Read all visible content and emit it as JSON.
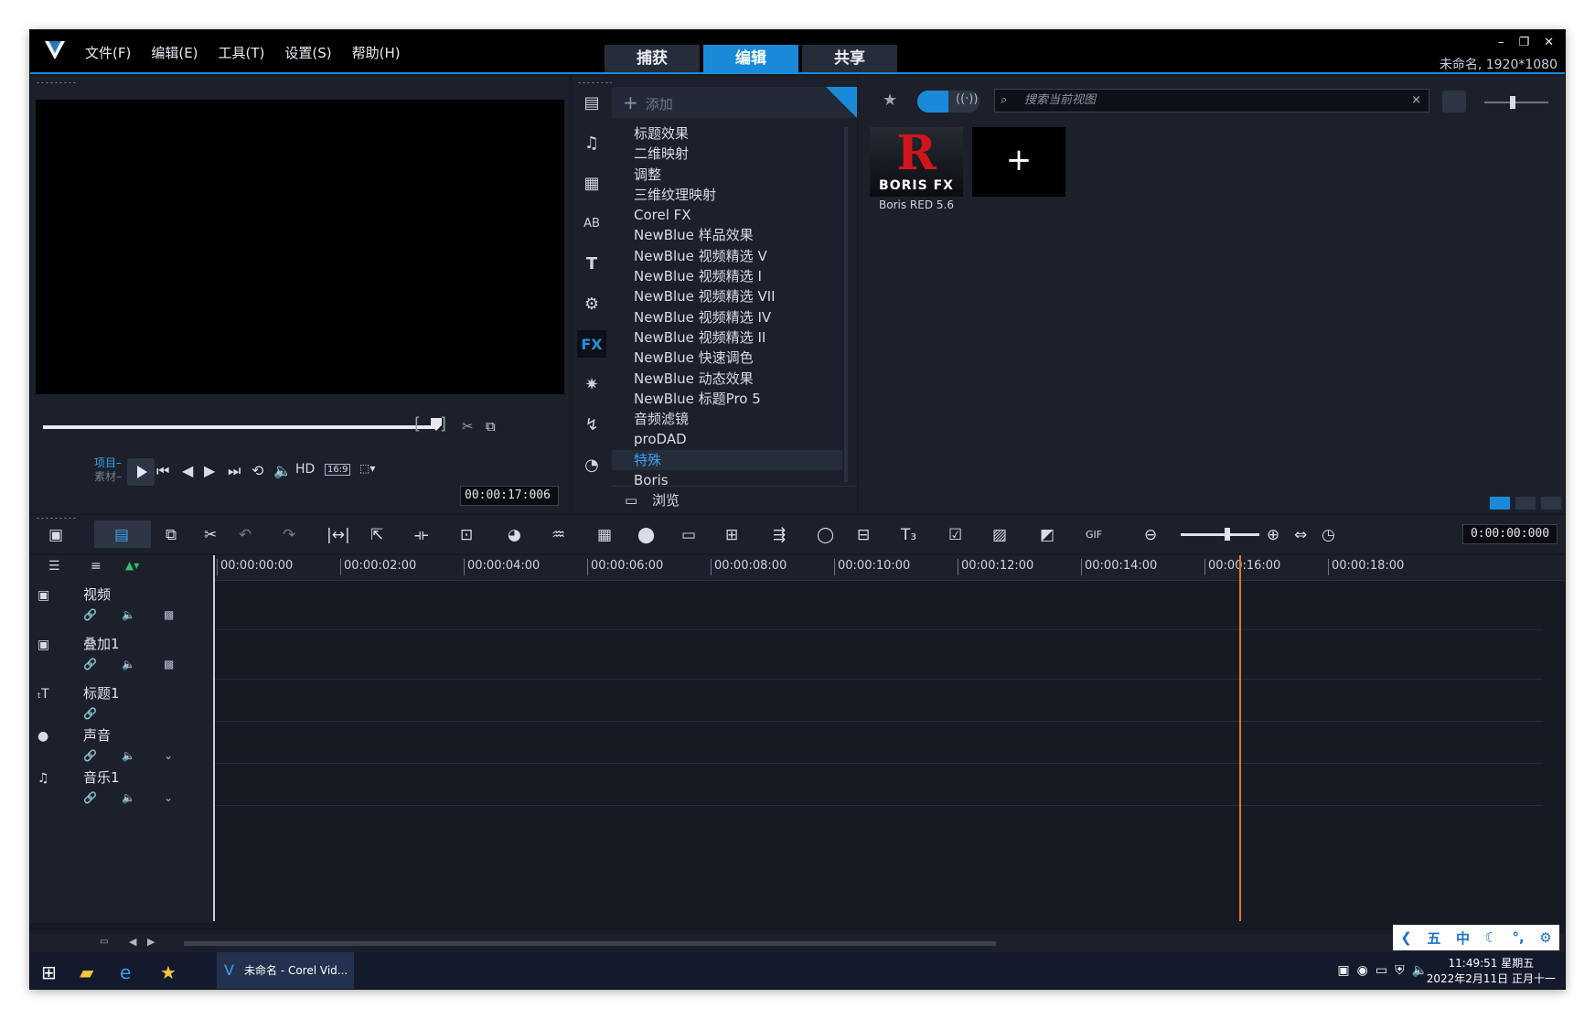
{
  "menu": [
    "文件(F)",
    "编辑(E)",
    "工具(T)",
    "设置(S)",
    "帮助(H)"
  ],
  "modes": [
    "捕获",
    "编辑",
    "共享"
  ],
  "window": {
    "project_info": "未命名, 1920*1080"
  },
  "preview": {
    "project_label": "项目",
    "clip_label": "素材",
    "hd_label": "HD",
    "ratio_label": "16:9",
    "timecode": "00:00:17:006"
  },
  "library": {
    "add_label": "添加",
    "categories": [
      "标题效果",
      "二维映射",
      "调整",
      "三维纹理映射",
      "Corel FX",
      "NewBlue 样品效果",
      "NewBlue 视频精选 V",
      "NewBlue 视频精选 I",
      "NewBlue 视频精选 VII",
      "NewBlue 视频精选 IV",
      "NewBlue 视频精选 II",
      "NewBlue 快速调色",
      "NewBlue 动态效果",
      "NewBlue 标题Pro 5",
      "音频滤镜",
      "proDAD",
      "特殊",
      "Boris"
    ],
    "selected_index": 16,
    "browse_label": "浏览",
    "fx_tab_label": "FX"
  },
  "effects": {
    "search_placeholder": "搜索当前视图",
    "thumbnail": {
      "brand_letter": "R",
      "brand_text": "BORIS FX",
      "label": "Boris RED 5.6"
    },
    "add_symbol": "+"
  },
  "timeline": {
    "timecode": "0:00:00:000",
    "ruler": [
      "00:00:00:00",
      "00:00:02:00",
      "00:00:04:00",
      "00:00:06:00",
      "00:00:08:00",
      "00:00:10:00",
      "00:00:12:00",
      "00:00:14:00",
      "00:00:16:00",
      "00:00:18:00"
    ],
    "tracks": [
      "视频",
      "叠加1",
      "标题1",
      "声音",
      "音乐1"
    ]
  },
  "ime": [
    "五",
    "中"
  ],
  "taskbar": {
    "app_title": "未命名 - Corel Vid...",
    "time": "11:49:51 星期五",
    "date": "2022年2月11日 正月十一"
  },
  "colors": {
    "accent": "#1a8ad8",
    "playhead": "#e6762a",
    "background": "#161a23"
  }
}
